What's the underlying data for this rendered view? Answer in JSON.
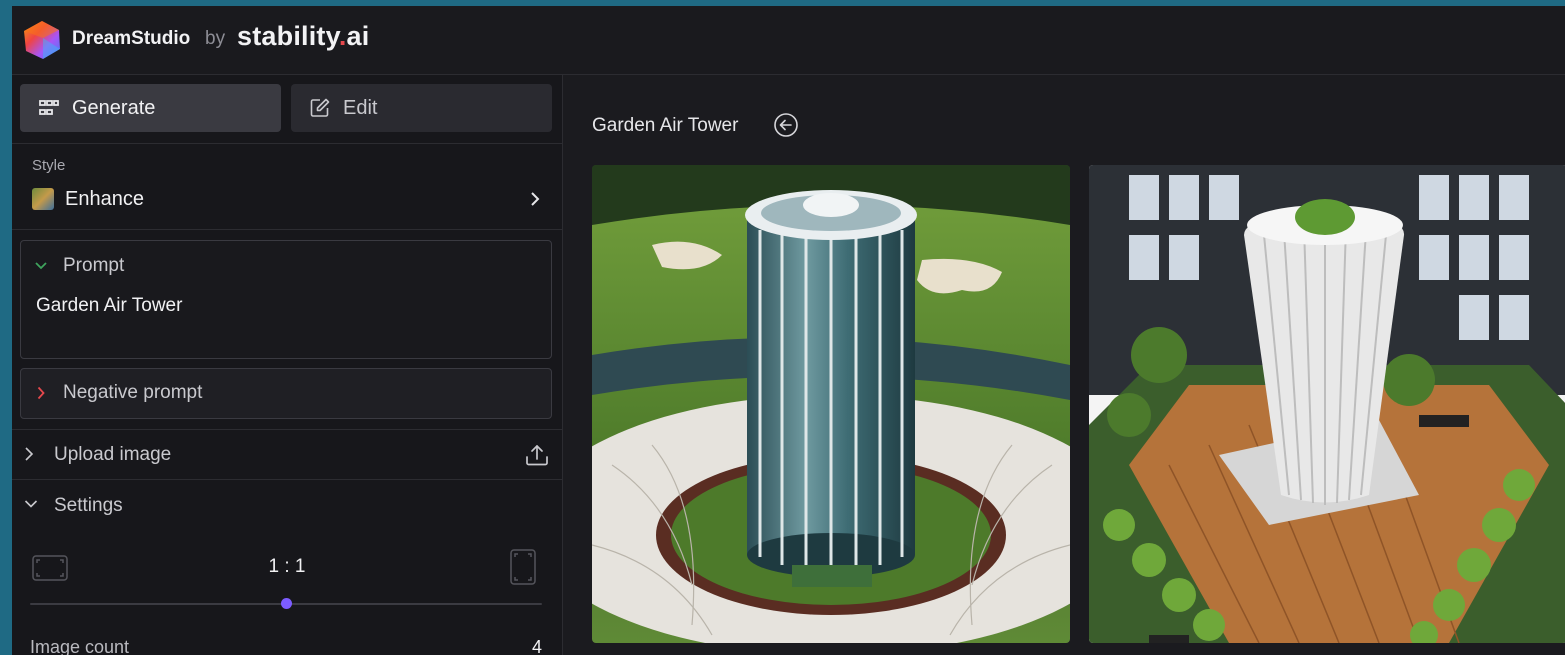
{
  "header": {
    "brand": "DreamStudio",
    "by": "by",
    "company_main": "stability",
    "company_dot": ".",
    "company_suffix": "ai"
  },
  "mode_tabs": [
    {
      "label": "Generate",
      "icon": "grid-icon",
      "active": true
    },
    {
      "label": "Edit",
      "icon": "pencil-square-icon",
      "active": false
    }
  ],
  "style": {
    "label": "Style",
    "value": "Enhance",
    "icon": "enhance-style-thumbnail"
  },
  "prompt": {
    "label": "Prompt",
    "value": "Garden Air Tower",
    "expanded": true
  },
  "negative_prompt": {
    "label": "Negative prompt",
    "expanded": false
  },
  "upload_image": {
    "label": "Upload image",
    "icon": "upload-icon"
  },
  "settings": {
    "label": "Settings",
    "aspect_ratio": "1 : 1",
    "aspect_ratio_position": 0.5,
    "image_count_label": "Image count",
    "image_count_value": "4"
  },
  "main": {
    "title": "Garden Air Tower",
    "images": [
      {
        "name": "tower-on-golf-course"
      },
      {
        "name": "white-tower-in-rooftop-garden"
      }
    ]
  },
  "colors": {
    "accent": "#7c5cff",
    "prompt_chevron": "#3fa45d",
    "negative_chevron": "#e5484d",
    "logo_dot": "#e5484d"
  }
}
